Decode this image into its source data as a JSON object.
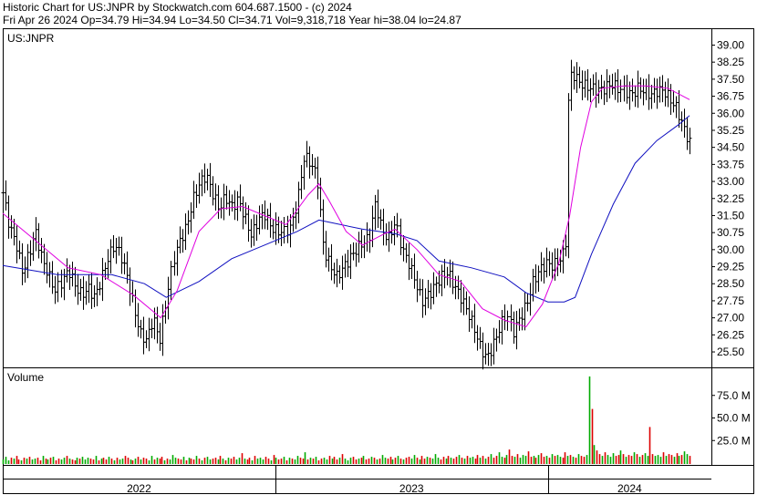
{
  "header": {
    "line1": "Historic Chart for US:JNPR by Stockwatch.com 604.687.1500 - (c) 2024",
    "line2": "Fri Apr 26 2024   Op=34.79   Hi=34.94   Lo=34.50   Cl=34.71   Vol=9,318,718   Year hi=38.04   lo=24.87"
  },
  "colors": {
    "price": "#000000",
    "ma_short": "#e000e0",
    "ma_long": "#1010c0",
    "vol_up": "#00aa00",
    "vol_down": "#dd0000",
    "frame": "#000000"
  },
  "chart_data": [
    {
      "type": "line",
      "title": "US:JNPR",
      "x_labels": [
        "2022",
        "2023",
        "2024"
      ],
      "x_label_pos": [
        0.25,
        0.75,
        1.15
      ],
      "x_dividers": [
        0.5,
        1.0
      ],
      "x_range": [
        0.0,
        1.3
      ],
      "ylim": [
        24.9,
        39.5
      ],
      "y_ticks": [
        "39.00",
        "38.25",
        "37.50",
        "36.75",
        "36.00",
        "35.25",
        "34.50",
        "33.75",
        "33.00",
        "32.25",
        "31.50",
        "30.75",
        "30.00",
        "29.25",
        "28.50",
        "27.75",
        "27.00",
        "26.25",
        "25.50"
      ],
      "grid": false,
      "price_points": [
        [
          0.0,
          32.5
        ],
        [
          0.012,
          31.0
        ],
        [
          0.024,
          30.3
        ],
        [
          0.036,
          29.0
        ],
        [
          0.048,
          29.8
        ],
        [
          0.06,
          30.8
        ],
        [
          0.072,
          29.6
        ],
        [
          0.084,
          28.9
        ],
        [
          0.096,
          28.2
        ],
        [
          0.108,
          28.6
        ],
        [
          0.12,
          29.1
        ],
        [
          0.132,
          28.4
        ],
        [
          0.144,
          28.0
        ],
        [
          0.156,
          28.3
        ],
        [
          0.168,
          27.9
        ],
        [
          0.18,
          28.7
        ],
        [
          0.192,
          29.6
        ],
        [
          0.204,
          30.2
        ],
        [
          0.216,
          29.8
        ],
        [
          0.228,
          28.8
        ],
        [
          0.24,
          27.5
        ],
        [
          0.252,
          26.3
        ],
        [
          0.264,
          26.0
        ],
        [
          0.276,
          27.0
        ],
        [
          0.288,
          26.0
        ],
        [
          0.3,
          27.8
        ],
        [
          0.312,
          29.5
        ],
        [
          0.324,
          30.4
        ],
        [
          0.336,
          31.0
        ],
        [
          0.348,
          32.2
        ],
        [
          0.36,
          32.9
        ],
        [
          0.372,
          33.3
        ],
        [
          0.384,
          32.5
        ],
        [
          0.396,
          31.8
        ],
        [
          0.408,
          32.3
        ],
        [
          0.42,
          31.9
        ],
        [
          0.432,
          32.2
        ],
        [
          0.444,
          31.4
        ],
        [
          0.456,
          30.6
        ],
        [
          0.468,
          31.3
        ],
        [
          0.48,
          31.6
        ],
        [
          0.492,
          31.0
        ],
        [
          0.504,
          30.8
        ],
        [
          0.516,
          30.8
        ],
        [
          0.528,
          31.0
        ],
        [
          0.54,
          32.2
        ],
        [
          0.552,
          34.1
        ],
        [
          0.564,
          33.8
        ],
        [
          0.576,
          33.2
        ],
        [
          0.588,
          30.0
        ],
        [
          0.6,
          29.3
        ],
        [
          0.612,
          28.8
        ],
        [
          0.624,
          29.2
        ],
        [
          0.636,
          29.6
        ],
        [
          0.648,
          30.0
        ],
        [
          0.66,
          30.3
        ],
        [
          0.672,
          30.5
        ],
        [
          0.684,
          32.1
        ],
        [
          0.696,
          30.8
        ],
        [
          0.708,
          30.5
        ],
        [
          0.72,
          31.2
        ],
        [
          0.732,
          30.0
        ],
        [
          0.744,
          29.4
        ],
        [
          0.756,
          28.6
        ],
        [
          0.768,
          27.7
        ],
        [
          0.78,
          28.0
        ],
        [
          0.792,
          28.4
        ],
        [
          0.804,
          28.8
        ],
        [
          0.816,
          29.0
        ],
        [
          0.828,
          28.4
        ],
        [
          0.84,
          27.9
        ],
        [
          0.852,
          27.3
        ],
        [
          0.864,
          26.6
        ],
        [
          0.876,
          25.7
        ],
        [
          0.888,
          25.2
        ],
        [
          0.9,
          25.8
        ],
        [
          0.912,
          26.6
        ],
        [
          0.924,
          27.2
        ],
        [
          0.936,
          26.4
        ],
        [
          0.948,
          27.0
        ],
        [
          0.96,
          27.6
        ],
        [
          0.972,
          28.6
        ],
        [
          0.984,
          29.1
        ],
        [
          0.996,
          29.4
        ],
        [
          1.008,
          29.3
        ],
        [
          1.02,
          29.5
        ],
        [
          1.032,
          30.0
        ],
        [
          1.038,
          37.3
        ],
        [
          1.044,
          37.8
        ],
        [
          1.056,
          37.4
        ],
        [
          1.068,
          37.2
        ],
        [
          1.08,
          37.1
        ],
        [
          1.092,
          37.0
        ],
        [
          1.104,
          37.1
        ],
        [
          1.116,
          37.3
        ],
        [
          1.128,
          37.1
        ],
        [
          1.14,
          37.0
        ],
        [
          1.152,
          36.8
        ],
        [
          1.164,
          37.1
        ],
        [
          1.176,
          37.0
        ],
        [
          1.188,
          36.8
        ],
        [
          1.2,
          37.0
        ],
        [
          1.212,
          37.0
        ],
        [
          1.224,
          36.6
        ],
        [
          1.236,
          36.2
        ],
        [
          1.248,
          35.4
        ],
        [
          1.26,
          34.7
        ]
      ],
      "ma_short_points": [
        [
          0.0,
          31.6
        ],
        [
          0.06,
          30.4
        ],
        [
          0.12,
          29.2
        ],
        [
          0.18,
          28.9
        ],
        [
          0.24,
          28.0
        ],
        [
          0.29,
          27.0
        ],
        [
          0.32,
          28.2
        ],
        [
          0.36,
          30.8
        ],
        [
          0.4,
          31.8
        ],
        [
          0.44,
          31.9
        ],
        [
          0.48,
          31.5
        ],
        [
          0.52,
          31.1
        ],
        [
          0.56,
          32.4
        ],
        [
          0.58,
          32.9
        ],
        [
          0.6,
          32.1
        ],
        [
          0.63,
          30.8
        ],
        [
          0.66,
          30.2
        ],
        [
          0.7,
          30.7
        ],
        [
          0.72,
          30.9
        ],
        [
          0.76,
          30.0
        ],
        [
          0.8,
          28.9
        ],
        [
          0.84,
          28.6
        ],
        [
          0.88,
          27.4
        ],
        [
          0.92,
          26.9
        ],
        [
          0.96,
          26.6
        ],
        [
          0.99,
          27.6
        ],
        [
          1.02,
          29.4
        ],
        [
          1.04,
          31.5
        ],
        [
          1.06,
          34.5
        ],
        [
          1.08,
          36.5
        ],
        [
          1.1,
          37.1
        ],
        [
          1.14,
          37.2
        ],
        [
          1.18,
          37.2
        ],
        [
          1.22,
          37.1
        ],
        [
          1.26,
          36.6
        ]
      ],
      "ma_long_points": [
        [
          0.0,
          29.3
        ],
        [
          0.1,
          28.9
        ],
        [
          0.2,
          28.9
        ],
        [
          0.26,
          28.5
        ],
        [
          0.3,
          27.9
        ],
        [
          0.36,
          28.6
        ],
        [
          0.42,
          29.6
        ],
        [
          0.48,
          30.2
        ],
        [
          0.54,
          30.8
        ],
        [
          0.58,
          31.3
        ],
        [
          0.6,
          31.2
        ],
        [
          0.66,
          30.9
        ],
        [
          0.72,
          30.7
        ],
        [
          0.76,
          30.4
        ],
        [
          0.8,
          29.5
        ],
        [
          0.86,
          29.2
        ],
        [
          0.92,
          28.8
        ],
        [
          0.96,
          28.1
        ],
        [
          1.0,
          27.7
        ],
        [
          1.03,
          27.7
        ],
        [
          1.05,
          27.9
        ],
        [
          1.08,
          29.8
        ],
        [
          1.12,
          32.0
        ],
        [
          1.16,
          33.8
        ],
        [
          1.2,
          34.8
        ],
        [
          1.24,
          35.5
        ],
        [
          1.26,
          35.9
        ]
      ]
    },
    {
      "type": "bar",
      "title": "Volume",
      "y_ticks": [
        "75.0 M",
        "50.0 M",
        "25.0 M"
      ],
      "ylim": [
        0,
        100
      ],
      "volume_m": [
        4,
        7,
        3,
        6,
        5,
        8,
        4,
        3,
        6,
        5,
        7,
        4,
        5,
        6,
        3,
        8,
        5,
        4,
        6,
        7,
        3,
        5,
        4,
        6,
        8,
        5,
        4,
        3,
        6,
        5,
        7,
        4,
        6,
        5,
        4,
        8,
        3,
        5,
        6,
        4,
        7,
        5,
        3,
        6,
        4,
        5,
        8,
        6,
        4,
        3,
        5,
        7,
        4,
        6,
        5,
        3,
        8,
        4,
        6,
        5,
        7,
        3,
        5,
        4,
        9,
        6,
        5,
        4,
        7,
        3,
        6,
        5,
        4,
        8,
        5,
        3,
        6,
        7,
        4,
        5,
        6,
        4,
        8,
        5,
        3,
        6,
        5,
        7,
        4,
        6,
        11,
        5,
        4,
        6,
        3,
        8,
        5,
        6,
        4,
        7,
        5,
        3,
        9,
        6,
        4,
        5,
        7,
        3,
        6,
        5,
        4,
        8,
        6,
        5,
        12,
        4,
        6,
        5,
        7,
        3,
        5,
        6,
        4,
        8,
        5,
        7,
        4,
        6,
        10,
        5,
        3,
        6,
        7,
        4,
        5,
        6,
        8,
        4,
        5,
        7,
        6,
        4,
        5,
        9,
        6,
        5,
        7,
        4,
        6,
        8,
        5,
        4,
        6,
        7,
        5,
        9,
        6,
        4,
        8,
        5,
        7,
        6,
        5,
        10,
        6,
        4,
        7,
        5,
        8,
        6,
        5,
        7,
        9,
        6,
        5,
        8,
        6,
        7,
        5,
        9,
        6,
        8,
        5,
        7,
        10,
        6,
        8,
        12,
        7,
        6,
        9,
        15,
        8,
        7,
        10,
        6,
        9,
        8,
        13,
        7,
        8,
        6,
        9,
        11,
        7,
        8,
        6,
        10,
        8,
        9,
        7,
        6,
        12,
        8,
        9,
        7,
        6,
        10,
        8,
        7,
        9,
        96,
        60,
        20,
        14,
        10,
        8,
        12,
        9,
        7,
        11,
        8,
        9,
        14,
        10,
        7,
        9,
        8,
        12,
        10,
        7,
        9,
        11,
        8,
        40,
        10,
        8,
        9,
        7,
        12,
        8,
        10,
        9,
        7,
        11,
        8,
        9,
        13,
        10,
        8
      ],
      "up_flags": "gggrgrrgrgrggrrgrgrgrrggrgrrgrgggrrgrgrrgrgrggrrgrgrgrrggrgrrgrgggrrgrgrrgrgrggrrgrgrgrrggrgrrgrgggrrgrgrrgrgrggrrgrgrgrrggrgrrgrgggrrgrgrrgrgrggrrgrgrgrrggrgrrgrgggrrgrgrrgrgrggrrgrgrgrrggrgrrgrgggrrgrgrrgrgrggrrgrgrgrrggrgrrgrgggrrgrgrrgrgrggrr"
    }
  ]
}
